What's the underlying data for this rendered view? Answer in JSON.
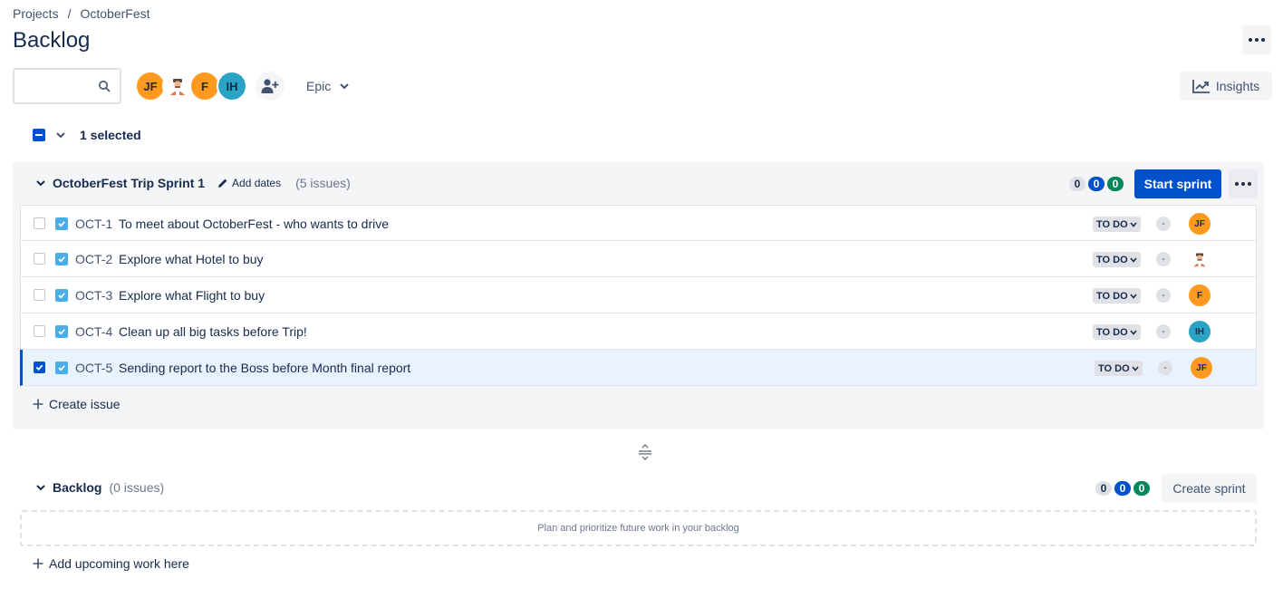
{
  "breadcrumb": {
    "root": "Projects",
    "separator": "/",
    "project": "OctoberFest"
  },
  "page": {
    "title": "Backlog"
  },
  "toolbar": {
    "search_value": "",
    "avatars": [
      {
        "initials": "JF",
        "color": "#ff991f"
      },
      {
        "initials": "",
        "color": "#ffffff"
      },
      {
        "initials": "F",
        "color": "#ff991f"
      },
      {
        "initials": "IH",
        "color": "#2aa3c4"
      }
    ],
    "epic_label": "Epic",
    "insights_label": "Insights"
  },
  "selection": {
    "label": "1 selected"
  },
  "sprint": {
    "name": "OctoberFest Trip Sprint 1",
    "add_dates": "Add dates",
    "issue_count": "(5 issues)",
    "counts": [
      "0",
      "0",
      "0"
    ],
    "start_label": "Start sprint",
    "issues": [
      {
        "key": "OCT-1",
        "summary": "To meet about OctoberFest - who wants to drive",
        "status": "TO DO",
        "estimate": "-",
        "assignee": "JF",
        "selected": false
      },
      {
        "key": "OCT-2",
        "summary": "Explore what Hotel to buy",
        "status": "TO DO",
        "estimate": "-",
        "assignee": "",
        "selected": false
      },
      {
        "key": "OCT-3",
        "summary": "Explore what Flight to buy",
        "status": "TO DO",
        "estimate": "-",
        "assignee": "F",
        "selected": false
      },
      {
        "key": "OCT-4",
        "summary": "Clean up all big tasks before Trip!",
        "status": "TO DO",
        "estimate": "-",
        "assignee": "IH",
        "selected": false
      },
      {
        "key": "OCT-5",
        "summary": "Sending report to the Boss before Month final report",
        "status": "TO DO",
        "estimate": "-",
        "assignee": "JF",
        "selected": true
      }
    ],
    "create_issue": "Create issue"
  },
  "backlog": {
    "name": "Backlog",
    "issue_count": "(0 issues)",
    "counts": [
      "0",
      "0",
      "0"
    ],
    "create_sprint": "Create sprint",
    "empty_text": "Plan and prioritize future work in your backlog",
    "add_upcoming": "Add upcoming work here"
  },
  "colors": {
    "primary": "#0052cc",
    "done": "#00875a",
    "story": "#4bade8"
  }
}
